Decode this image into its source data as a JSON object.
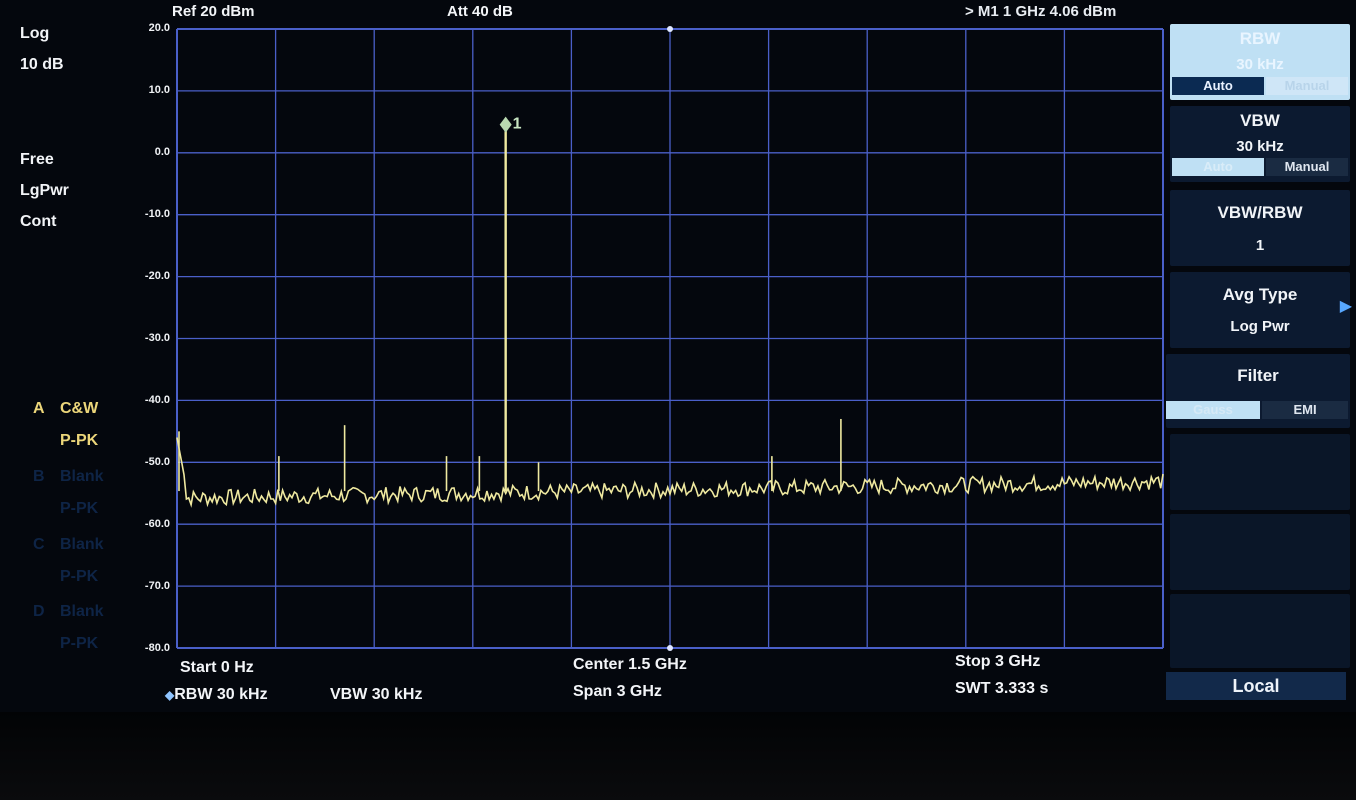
{
  "header": {
    "ref": "Ref  20 dBm",
    "att": "Att  40 dB",
    "marker_readout": ">  M1    1 GHz   4.06 dBm"
  },
  "left_panel": {
    "scale_type": "Log",
    "scale_div": "10 dB",
    "trigger": "Free",
    "avg_type": "LgPwr",
    "sweep_mode": "Cont",
    "traces": [
      {
        "letter": "A",
        "mode": "C&W",
        "detector": "P-PK",
        "active": true
      },
      {
        "letter": "B",
        "mode": "Blank",
        "detector": "P-PK",
        "active": false
      },
      {
        "letter": "C",
        "mode": "Blank",
        "detector": "P-PK",
        "active": false
      },
      {
        "letter": "D",
        "mode": "Blank",
        "detector": "P-PK",
        "active": false
      }
    ]
  },
  "y_axis_labels": [
    "20.0",
    "10.0",
    "0.0",
    "-10.0",
    "-20.0",
    "-30.0",
    "-40.0",
    "-50.0",
    "-60.0",
    "-70.0",
    "-80.0"
  ],
  "marker": {
    "label": "1",
    "freq_ghz": 1.0,
    "level_dbm": 4.06
  },
  "footer": {
    "start": "Start  0 Hz",
    "rbw": "RBW  30 kHz",
    "vbw": "VBW  30 kHz",
    "center": "Center   1.5 GHz",
    "span": "Span     3 GHz",
    "stop": "Stop   3 GHz",
    "swt": "SWT   3.333 s"
  },
  "softkeys": {
    "rbw": {
      "title": "RBW",
      "value": "30 kHz",
      "auto": "Auto",
      "manual": "Manual",
      "mode": "Auto"
    },
    "vbw": {
      "title": "VBW",
      "value": "30 kHz",
      "auto": "Auto",
      "manual": "Manual",
      "mode": "Auto"
    },
    "vbw_rbw": {
      "title": "VBW/RBW",
      "value": "1"
    },
    "avg_type": {
      "title": "Avg Type",
      "value": "Log Pwr"
    },
    "filter": {
      "title": "Filter",
      "gauss": "Gauss",
      "emi": "EMI",
      "mode": "Gauss"
    },
    "local": "Local"
  },
  "colors": {
    "grid": "#4a5fc8",
    "trace": "#efe9a0",
    "background": "#04070d",
    "panel": "#0c1a30",
    "active_trace_text": "#ecd67a"
  },
  "chart_data": {
    "type": "line",
    "title": "",
    "xlabel": "",
    "ylabel": "",
    "x_unit": "GHz",
    "y_unit": "dBm",
    "xlim": [
      0,
      3
    ],
    "ylim": [
      -80,
      20
    ],
    "noise_floor_dbm": -54,
    "spurs": [
      {
        "freq_ghz": 0.0,
        "level_dbm": -45
      },
      {
        "freq_ghz": 0.31,
        "level_dbm": -49
      },
      {
        "freq_ghz": 0.51,
        "level_dbm": -44
      },
      {
        "freq_ghz": 0.82,
        "level_dbm": -49
      },
      {
        "freq_ghz": 0.92,
        "level_dbm": -49
      },
      {
        "freq_ghz": 1.0,
        "level_dbm": 4.06
      },
      {
        "freq_ghz": 1.1,
        "level_dbm": -50
      },
      {
        "freq_ghz": 1.81,
        "level_dbm": -49
      },
      {
        "freq_ghz": 2.02,
        "level_dbm": -43
      }
    ]
  }
}
